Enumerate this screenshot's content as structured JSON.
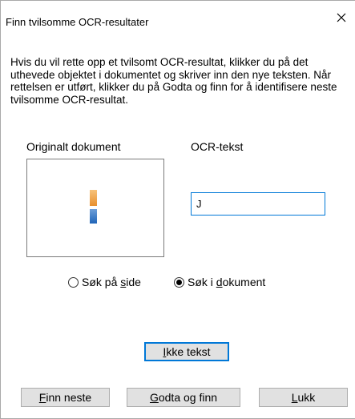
{
  "window": {
    "title": "Finn tvilsomme OCR-resultater",
    "close_icon": "close-icon"
  },
  "description": "Hvis du vil rette opp et tvilsomt OCR-resultat, klikker du på det uthevede objektet i dokumentet og skriver inn den nye teksten. Når rettelsen er utført, klikker du på Godta og finn for å identifisere neste tvilsomme OCR-resultat.",
  "labels": {
    "original": "Originalt dokument",
    "ocr": "OCR-tekst"
  },
  "preview": {
    "colors": {
      "top": "#e8902e",
      "bottom": "#1f64b8"
    }
  },
  "ocr_text": {
    "value": "J"
  },
  "search_scope": {
    "options": [
      {
        "prefix": "Søk på ",
        "access": "s",
        "suffix": "ide",
        "checked": false
      },
      {
        "prefix": "Søk i ",
        "access": "d",
        "suffix": "okument",
        "checked": true
      }
    ]
  },
  "buttons": {
    "not_text": {
      "access": "I",
      "rest": "kke tekst"
    },
    "find_next": {
      "access": "F",
      "rest": "inn neste"
    },
    "accept": {
      "access": "G",
      "rest": "odta og finn"
    },
    "close": {
      "access": "L",
      "rest": "ukk"
    }
  },
  "colors": {
    "accent": "#0078d7",
    "button_bg": "#e1e1e1"
  }
}
